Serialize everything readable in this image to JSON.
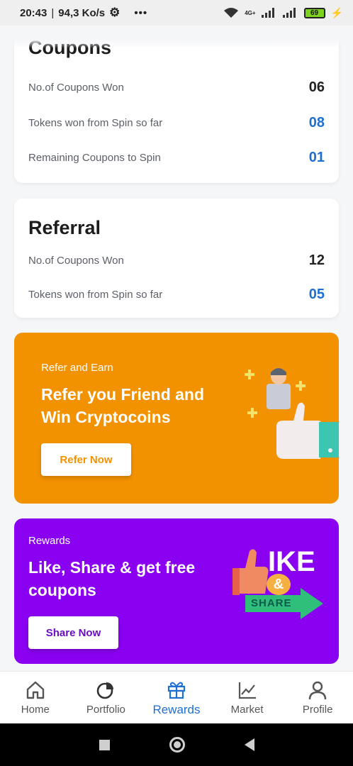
{
  "status_bar": {
    "time": "20:43",
    "network_speed": "94,3 Ko/s",
    "network_type": "4G+",
    "battery": "69",
    "icons": [
      "gear-icon",
      "more-icon",
      "wifi-icon",
      "signal-icon",
      "battery-icon",
      "charging-icon"
    ]
  },
  "coupons_card": {
    "title": "Coupons",
    "rows": [
      {
        "label": "No.of Coupons Won",
        "value": "06",
        "accent": false
      },
      {
        "label": "Tokens won from Spin so far",
        "value": "08",
        "accent": true
      },
      {
        "label": "Remaining Coupons to Spin",
        "value": "01",
        "accent": true
      }
    ]
  },
  "referral_card": {
    "title": "Referral",
    "rows": [
      {
        "label": "No.of Coupons Won",
        "value": "12",
        "accent": false
      },
      {
        "label": "Tokens won from Spin so far",
        "value": "05",
        "accent": true
      }
    ]
  },
  "refer_banner": {
    "kicker": "Refer and Earn",
    "headline_line1": "Refer you Friend and",
    "headline_line2": "Win Cryptocoins",
    "button": "Refer Now",
    "bg_color": "#f39200",
    "button_text_color": "#f39200"
  },
  "rewards_banner": {
    "kicker": "Rewards",
    "headline_line1": "Like, Share & get free",
    "headline_line2": "coupons",
    "button": "Share Now",
    "illustration_text_1": "IKE",
    "illustration_text_2": "&",
    "illustration_text_3": "SHARE",
    "bg_color": "#8a00f0",
    "button_text_color": "#6a0dc2"
  },
  "bottom_nav": {
    "items": [
      {
        "label": "Home",
        "icon": "home-icon"
      },
      {
        "label": "Portfolio",
        "icon": "pie-chart-icon"
      },
      {
        "label": "Rewards",
        "icon": "gift-icon",
        "active": true
      },
      {
        "label": "Market",
        "icon": "line-chart-icon"
      },
      {
        "label": "Profile",
        "icon": "user-icon"
      }
    ]
  },
  "system_nav": {
    "icons": [
      "recent-apps-icon",
      "home-circle-icon",
      "back-icon"
    ]
  },
  "colors": {
    "accent_blue": "#1f6fd1",
    "orange": "#f39200",
    "purple": "#8a00f0"
  }
}
